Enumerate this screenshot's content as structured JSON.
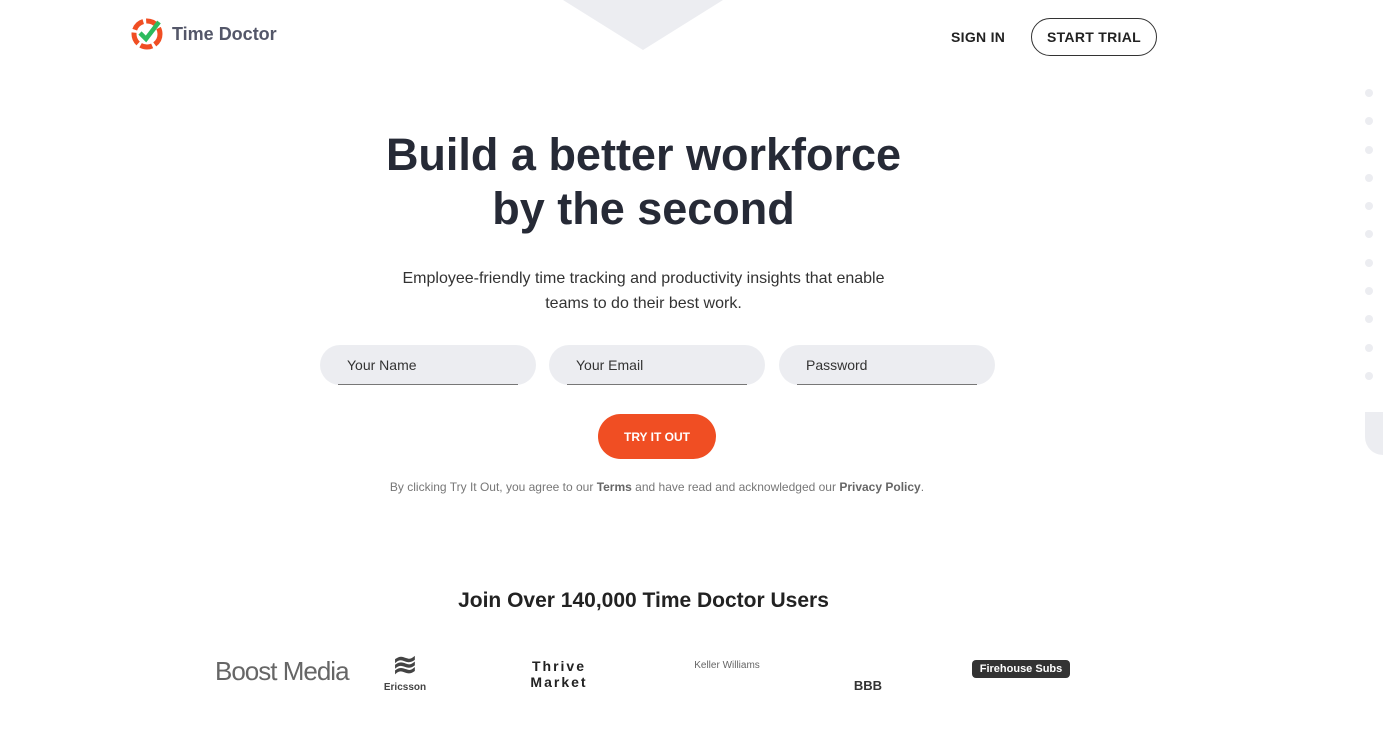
{
  "header": {
    "brand": "Time Doctor",
    "sign_in": "SIGN IN",
    "start_trial": "START TRIAL"
  },
  "hero": {
    "title_line1": "Build a better workforce",
    "title_line2": "by the second",
    "subtitle_line1": "Employee-friendly time tracking and productivity insights that enable",
    "subtitle_line2": "teams to do their best work."
  },
  "form": {
    "name_placeholder": "Your Name",
    "email_placeholder": "Your Email",
    "password_placeholder": "Password",
    "submit": "TRY IT OUT"
  },
  "legal": {
    "prefix": "By clicking Try It Out, you agree to our ",
    "terms": "Terms",
    "middle": " and have read and acknowledged our ",
    "privacy": "Privacy Policy",
    "suffix": "."
  },
  "customers": {
    "heading": "Join Over 140,000 Time Doctor Users",
    "logos": [
      "Boost Media",
      "Ericsson",
      "Thrive Market",
      "Keller Williams",
      "BBB",
      "Firehouse Subs"
    ]
  },
  "colors": {
    "accent": "#f04e23",
    "check": "#2dbb5d",
    "panel": "#ecedf1"
  }
}
